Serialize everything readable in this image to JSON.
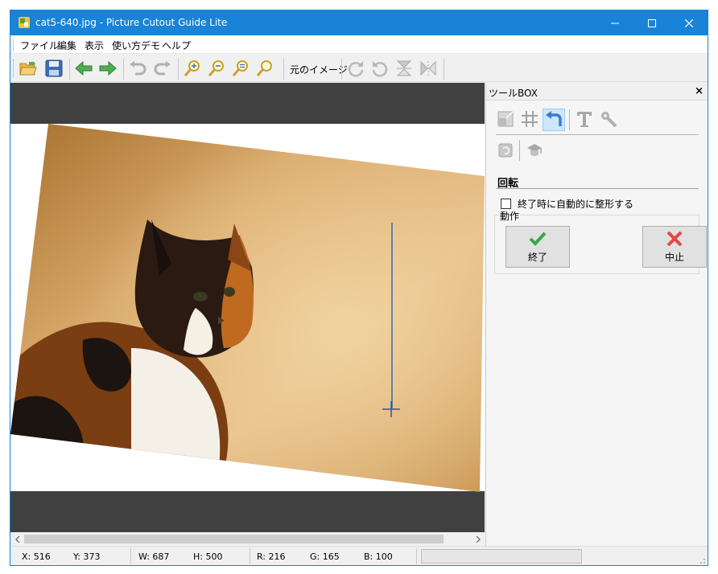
{
  "window": {
    "title": "cat5-640.jpg - Picture Cutout Guide Lite",
    "accent_color": "#1883d7",
    "controls": [
      "minimize-icon",
      "maximize-icon",
      "close-icon"
    ]
  },
  "menu": {
    "items": [
      "ファイル",
      "編集",
      "表示",
      "使い方デモ",
      "ヘルプ"
    ]
  },
  "toolbar": {
    "buttons": [
      "open-folder-icon",
      "save-icon",
      "back-arrow-icon",
      "forward-arrow-icon",
      "undo-icon",
      "redo-icon",
      "zoom-in-icon",
      "zoom-out-icon",
      "zoom-fit-icon",
      "zoom-actual-icon"
    ],
    "original_image_label": "元のイメージ",
    "transform_buttons": [
      "rotate-right-icon",
      "rotate-left-icon",
      "flip-vertical-icon",
      "flip-horizontal-icon"
    ]
  },
  "toolbox": {
    "title": "ツールBOX",
    "close_label": "×",
    "row1_tools": [
      "crop-tool-icon",
      "grid-tool-icon",
      "rotate-tool-icon",
      "text-tool-icon",
      "wrench-tool-icon"
    ],
    "active_tool": "rotate-tool-icon",
    "row2_tools": [
      "restore-icon",
      "stamp-icon"
    ],
    "section_title": "回転",
    "auto_trim_label": "終了時に自動的に整形する",
    "auto_trim_checked": false,
    "action_group_label": "動作",
    "finish_label": "終了",
    "cancel_label": "中止"
  },
  "status": {
    "x": "X: 516",
    "y": "Y: 373",
    "w": "W: 687",
    "h": "H: 500",
    "r": "R: 216",
    "g": "G: 165",
    "b": "B: 100"
  }
}
